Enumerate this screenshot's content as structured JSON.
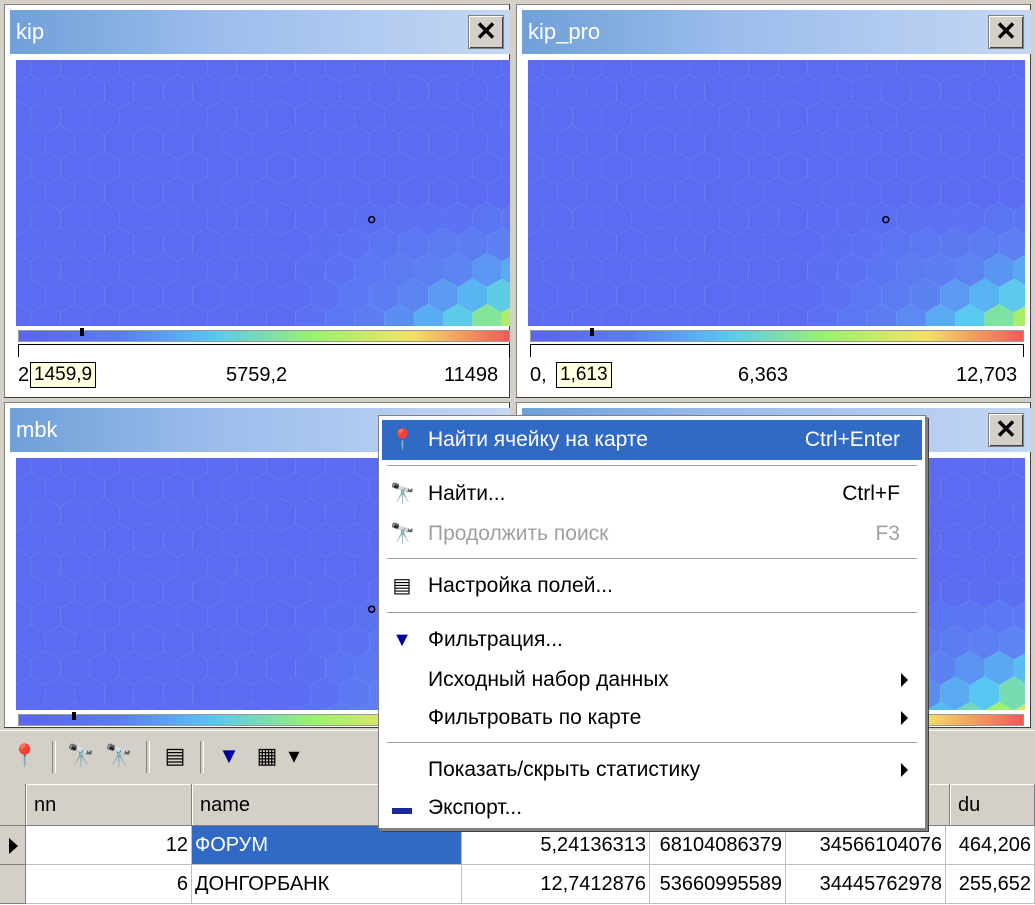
{
  "panels": [
    {
      "title": "kip",
      "ticks": [
        "2",
        "5759,2",
        "11498"
      ],
      "hint": "1459,9"
    },
    {
      "title": "kip_pro",
      "ticks": [
        "0,",
        "6,363",
        "12,703"
      ],
      "hint": "1,613"
    },
    {
      "title": "mbk",
      "ticks": [],
      "hint": ""
    },
    {
      "title": "",
      "ticks": [],
      "hint": ""
    }
  ],
  "close_glyph": "✕",
  "context_menu": {
    "items": [
      {
        "label": "Найти ячейку на карте",
        "shortcut": "Ctrl+Enter",
        "icon": "pin-icon",
        "glyph": "📍"
      },
      {
        "label": "Найти...",
        "shortcut": "Ctrl+F",
        "icon": "binoculars-icon",
        "glyph": "🔭"
      },
      {
        "label": "Продолжить поиск",
        "shortcut": "F3",
        "icon": "find-next-icon",
        "glyph": "🔭"
      },
      {
        "label": "Настройка полей...",
        "shortcut": "",
        "icon": "fields-settings-icon",
        "glyph": "▤"
      },
      {
        "label": "Фильтрация...",
        "shortcut": "",
        "icon": "filter-icon",
        "glyph": "▼"
      },
      {
        "label": "Исходный набор данных",
        "shortcut": "",
        "icon": "",
        "glyph": ""
      },
      {
        "label": "Фильтровать по карте",
        "shortcut": "",
        "icon": "",
        "glyph": ""
      },
      {
        "label": "Показать/скрыть статистику",
        "shortcut": "",
        "icon": "",
        "glyph": ""
      },
      {
        "label": "Экспорт...",
        "shortcut": "",
        "icon": "export-icon",
        "glyph": "▬"
      }
    ]
  },
  "grid": {
    "headers": [
      "nn",
      "name",
      "du"
    ],
    "rows": [
      {
        "nn": "12",
        "name": "ФОРУМ",
        "c3": "5,24136313",
        "c4": "68104086379",
        "c5": "34566104076",
        "du": "464,206"
      },
      {
        "nn": "6",
        "name": "ДОНГОРБАНК",
        "c3": "12,7412876",
        "c4": "53660995589",
        "c5": "34445762978",
        "du": "255,652"
      }
    ]
  },
  "toolbar": {
    "glyphs": {
      "find_cell": "📍",
      "find": "🔭",
      "find_next": "🔭",
      "fields": "▤",
      "filter": "▼",
      "table": "▦",
      "dropdown": "▾"
    }
  },
  "colors": {
    "map_base": "#5b68f2",
    "selection": "#316ac5",
    "title_gradient_start": "#6fa0d8"
  }
}
